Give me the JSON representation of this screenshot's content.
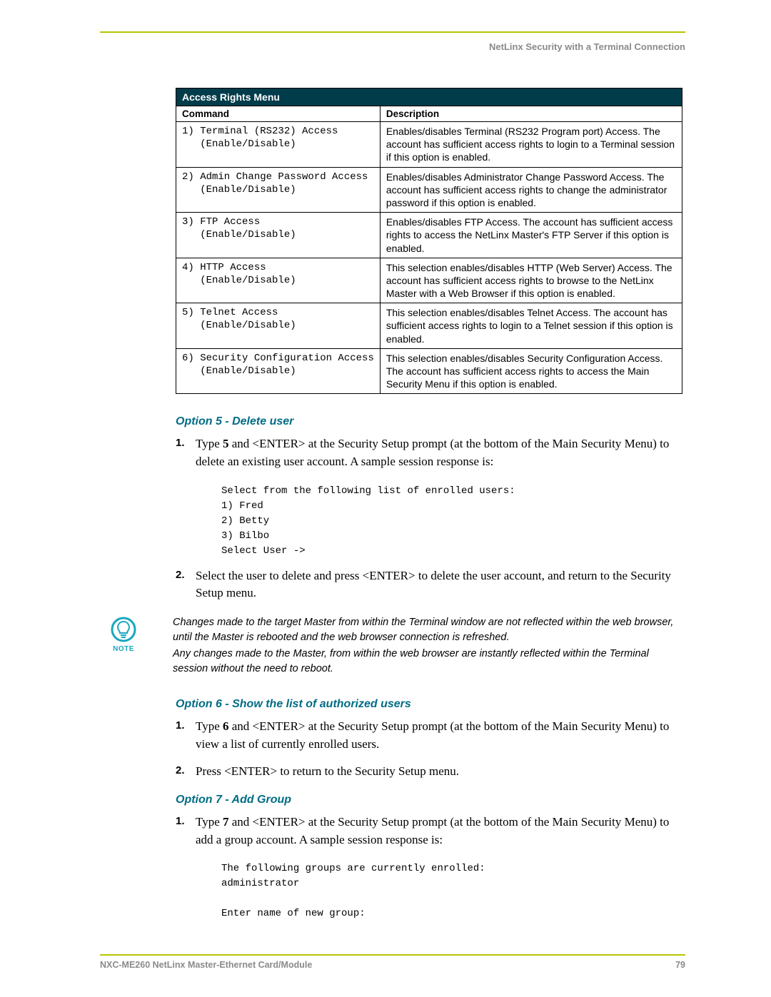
{
  "header": "NetLinx Security with a Terminal Connection",
  "table": {
    "title": "Access Rights Menu",
    "col1": "Command",
    "col2": "Description",
    "rows": [
      {
        "cmd": "1) Terminal (RS232) Access\n   (Enable/Disable)",
        "desc": "Enables/disables Terminal (RS232 Program port) Access. The account has sufficient access rights to login to a Terminal session if this option is enabled."
      },
      {
        "cmd": "2) Admin Change Password Access\n   (Enable/Disable)",
        "desc": "Enables/disables Administrator Change Password Access. The account has sufficient access rights to change the administrator password if this option is enabled."
      },
      {
        "cmd": "3) FTP Access\n   (Enable/Disable)",
        "desc": "Enables/disables FTP Access. The account has sufficient access rights to access the NetLinx Master's FTP Server if this option is enabled."
      },
      {
        "cmd": "4) HTTP Access\n   (Enable/Disable)",
        "desc": "This selection enables/disables HTTP (Web Server) Access. The account has sufficient access rights to browse to the NetLinx Master with a Web Browser if this option is enabled."
      },
      {
        "cmd": "5) Telnet Access\n   (Enable/Disable)",
        "desc": "This selection enables/disables Telnet Access. The account has sufficient access rights to login to a Telnet session if this option is enabled."
      },
      {
        "cmd": "6) Security Configuration Access\n   (Enable/Disable)",
        "desc": "This selection enables/disables Security Configuration Access. The account has sufficient access rights to access the Main Security Menu if this option is enabled."
      }
    ]
  },
  "opt5": {
    "head": "Option 5 - Delete user",
    "li1a": "Type ",
    "li1b": "5",
    "li1c": " and <ENTER> at the Security Setup prompt (at the bottom of the Main Security Menu) to delete an existing user account. A sample session response is:",
    "code": "Select from the following list of enrolled users:\n1) Fred\n2) Betty\n3) Bilbo\nSelect User ->",
    "li2": "Select the user to delete and press <ENTER> to delete the user account, and return to the Security Setup menu."
  },
  "note": {
    "label": "NOTE",
    "p1": "Changes made to the target Master from within the Terminal window are not reflected within the web browser, until the Master is rebooted and the web browser connection is refreshed.",
    "p2": "Any changes made to the Master, from within the web browser are instantly reflected within the Terminal session without the need to reboot."
  },
  "opt6": {
    "head": "Option 6 - Show the list of authorized users",
    "li1a": "Type ",
    "li1b": "6",
    "li1c": " and <ENTER> at the Security Setup prompt (at the bottom of the Main Security Menu) to view a list of currently enrolled users.",
    "li2": "Press <ENTER> to return to the Security Setup menu."
  },
  "opt7": {
    "head": "Option 7 - Add Group",
    "li1a": "Type ",
    "li1b": "7",
    "li1c": " and <ENTER> at the Security Setup prompt (at the bottom of the Main Security Menu) to add a group account. A sample session response is:",
    "code": "The following groups are currently enrolled:\nadministrator\n\nEnter name of new group:"
  },
  "footer": {
    "left": "NXC-ME260 NetLinx Master-Ethernet Card/Module",
    "right": "79"
  }
}
